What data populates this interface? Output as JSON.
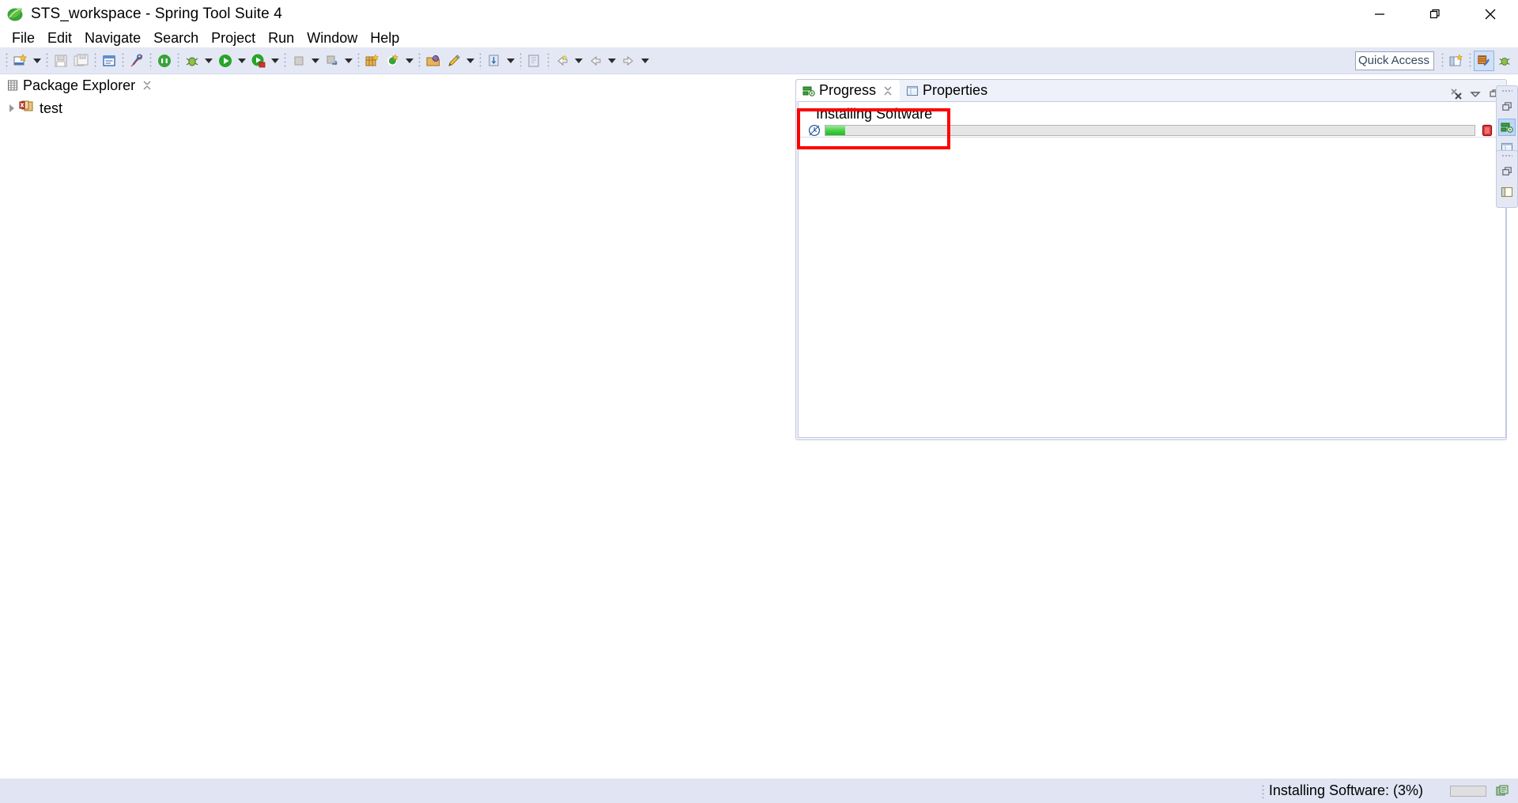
{
  "window": {
    "title": "STS_workspace - Spring Tool Suite 4",
    "app_icon": "spring-leaf-icon",
    "controls": {
      "minimize_label": "—",
      "restore_label": "❐",
      "close_label": "✕"
    }
  },
  "menubar": {
    "items": [
      {
        "label": "File"
      },
      {
        "label": "Edit"
      },
      {
        "label": "Navigate"
      },
      {
        "label": "Search"
      },
      {
        "label": "Project"
      },
      {
        "label": "Run"
      },
      {
        "label": "Window"
      },
      {
        "label": "Help"
      }
    ]
  },
  "toolbar": {
    "groups": [
      {
        "items": [
          {
            "icon": "new-wizard-icon",
            "dropdown": true
          }
        ]
      },
      {
        "items": [
          {
            "icon": "save-icon",
            "dropdown": false
          },
          {
            "icon": "save-all-icon",
            "dropdown": false
          }
        ]
      },
      {
        "items": [
          {
            "icon": "new-java-class-icon",
            "dropdown": false
          }
        ]
      },
      {
        "items": [
          {
            "icon": "link-broken-icon",
            "dropdown": false
          }
        ]
      },
      {
        "items": [
          {
            "icon": "spring-boot-dashboard-icon",
            "dropdown": false
          }
        ]
      },
      {
        "items": [
          {
            "icon": "debug-icon",
            "dropdown": true
          },
          {
            "icon": "run-icon",
            "dropdown": true
          },
          {
            "icon": "run-config-icon",
            "dropdown": true
          }
        ]
      },
      {
        "items": [
          {
            "icon": "stop-icon",
            "dropdown": true
          },
          {
            "icon": "relaunch-icon",
            "dropdown": true
          }
        ]
      },
      {
        "items": [
          {
            "icon": "new-package-icon",
            "dropdown": false
          },
          {
            "icon": "refresh-project-icon",
            "dropdown": true
          }
        ]
      },
      {
        "items": [
          {
            "icon": "open-type-icon",
            "dropdown": false
          },
          {
            "icon": "edit-icon",
            "dropdown": true
          }
        ]
      },
      {
        "items": [
          {
            "icon": "next-annotation-icon",
            "dropdown": true
          }
        ]
      },
      {
        "items": [
          {
            "icon": "open-task-icon",
            "dropdown": true
          }
        ]
      },
      {
        "items": [
          {
            "icon": "back-history-icon",
            "dropdown": false
          },
          {
            "icon": "back-icon",
            "dropdown": true
          },
          {
            "icon": "forward-icon",
            "dropdown": true
          }
        ]
      }
    ],
    "quick_access": {
      "value": "Quick Access",
      "placeholder": "Quick Access"
    },
    "perspective_buttons": [
      {
        "icon": "open-perspective-icon",
        "active": false
      },
      {
        "icon": "java-perspective-icon",
        "active": true
      },
      {
        "icon": "spring-perspective-icon",
        "active": false
      }
    ]
  },
  "package_explorer": {
    "tab": {
      "label": "Package Explorer",
      "icon": "package-explorer-icon",
      "close_icon": "close-icon",
      "active": true
    },
    "tree": [
      {
        "label": "test",
        "icon": "java-project-error-icon",
        "expanded": false,
        "twisty_icon": "chevron-right-icon"
      }
    ]
  },
  "progress_view": {
    "tabs": [
      {
        "label": "Progress",
        "icon": "progress-icon",
        "active": true,
        "close_icon": "close-icon"
      },
      {
        "label": "Properties",
        "icon": "properties-icon",
        "active": false
      }
    ],
    "toolbar": [
      {
        "icon": "remove-all-finished-icon"
      },
      {
        "icon": "view-menu-icon"
      },
      {
        "icon": "minimize-view-icon"
      }
    ],
    "tasks": [
      {
        "name": "Installing Software",
        "percent": 3,
        "clock_icon": "progress-clock-icon",
        "stop_icon": "stop-task-icon"
      }
    ]
  },
  "fast_view_bars": [
    {
      "buttons": [
        {
          "icon": "restore-icon",
          "active": false
        },
        {
          "icon": "progress-icon",
          "active": true
        },
        {
          "icon": "properties-icon",
          "active": false
        }
      ]
    },
    {
      "buttons": [
        {
          "icon": "restore-icon",
          "active": false
        },
        {
          "icon": "outline-icon",
          "active": false
        }
      ]
    }
  ],
  "statusbar": {
    "task_text": "Installing Software: (3%)",
    "progress_percent": 3,
    "icon": "show-progress-icon"
  },
  "colors": {
    "toolbar_bg": "#e4e8f5",
    "status_bg": "#e0e4f3",
    "annotation_red": "#ff0000",
    "progress_green": "#1fba1f",
    "tab_active_bg": "#ffffff"
  }
}
